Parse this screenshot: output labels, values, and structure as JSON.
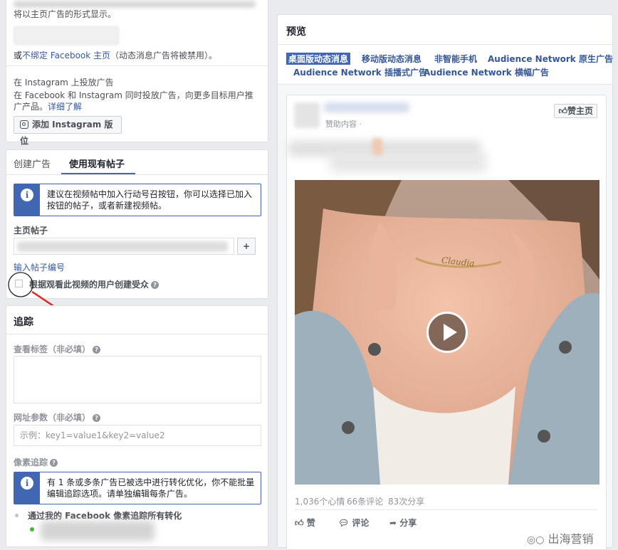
{
  "left": {
    "top_text": "将以主页广告的形式显示。",
    "unlink_text": {
      "pre": "或",
      "link": "不绑定 Facebook 主页",
      "post": "（动态消息广告将被禁用）。"
    },
    "instagram": {
      "heading": "在 Instagram 上投放广告",
      "desc": "在 Facebook 和 Instagram 同时投放广告，向更多目标用户推广产品。",
      "learn_more": "详细了解",
      "add_button": "添加 Instagram 版位"
    },
    "tabs": [
      {
        "label": "创建广告"
      },
      {
        "label": "使用现有帖子"
      }
    ],
    "notice1": "建议在视频帖中加入行动号召按钮，你可以选择已加入按钮的帖子，或者新建视频帖。",
    "page_post_label": "主页帖子",
    "add_symbol": "+",
    "enter_post_id": "输入帖子编号",
    "audience_checkbox_label": "根据观看此视频的用户创建受众",
    "tracking": {
      "title": "追踪",
      "view_tags_label": "查看标签（非必填）",
      "url_params_label": "网址参数（非必填）",
      "url_params_placeholder": "示例：key1=value1&key2=value2",
      "pixel_label": "像素追踪",
      "notice2": "有 1 条或多条广告已被选中进行转化优化，你不能批量编辑追踪选项。请单独编辑每条广告。",
      "track_all": "通过我的 Facebook 像素追踪所有转化"
    }
  },
  "preview": {
    "title": "预览",
    "tabs": [
      {
        "label": "桌面版动态消息"
      },
      {
        "label": "移动版动态消息"
      },
      {
        "label": "非智能手机"
      },
      {
        "label": "Audience Network 原生广告"
      },
      {
        "label": "Audience Network 插播式广告"
      },
      {
        "label": "Audience Network 横幅广告"
      }
    ],
    "like_page": "赞主页",
    "sponsored": "赞助内容 ·",
    "necklace_text": "Claudia",
    "stats": {
      "reactions": "1,036个心情",
      "comments": "66条评论",
      "shares": "83次分享"
    },
    "actions": {
      "like": "赞",
      "comment": "评论",
      "share": "分享"
    }
  },
  "watermark": "出海营销"
}
